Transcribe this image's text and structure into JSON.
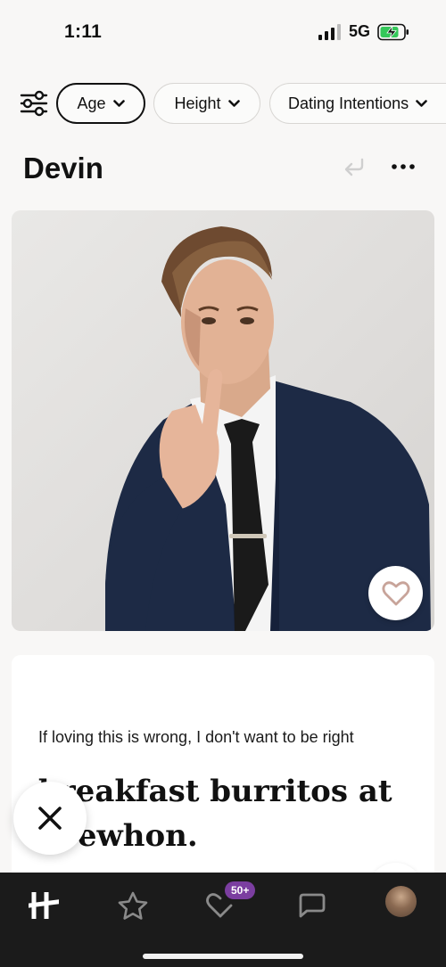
{
  "status_bar": {
    "time": "1:11",
    "network": "5G",
    "battery_color": "#34c759"
  },
  "filters": {
    "icon": "sliders-icon",
    "chips": [
      {
        "label": "Age",
        "active": true
      },
      {
        "label": "Height",
        "active": false
      },
      {
        "label": "Dating Intentions",
        "active": false
      }
    ]
  },
  "profile": {
    "name": "Devin",
    "undo_icon": "undo-icon",
    "more_icon": "more-dots-icon"
  },
  "prompt": {
    "question": "If loving this is wrong, I don't want to be right",
    "answer_line1": "breakfast burritos at",
    "answer_line2": "Erewhon."
  },
  "nav": {
    "items": [
      "home-logo-icon",
      "star-icon",
      "likes-icon",
      "chat-icon",
      "profile-avatar"
    ],
    "likes_badge": "50+",
    "badge_color": "#7b3ea0"
  },
  "colors": {
    "accent_heart": "#c8a49a",
    "nav_background": "#1b1b1b"
  }
}
